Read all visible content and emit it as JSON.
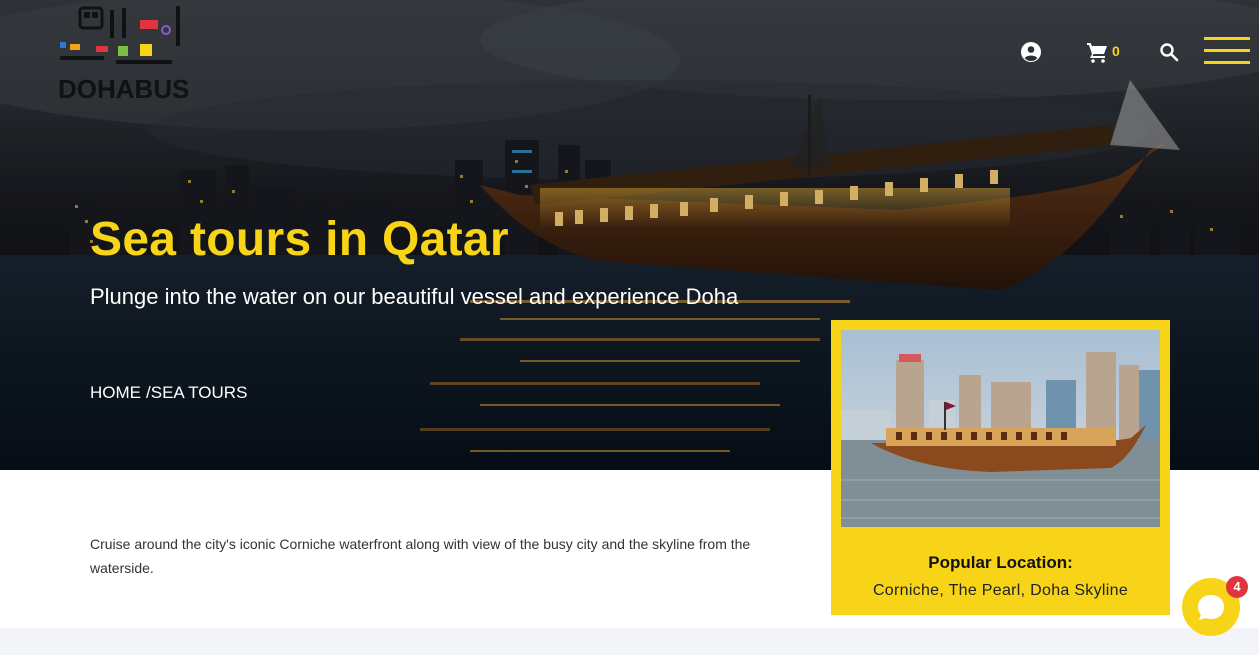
{
  "brand": {
    "logo_text": "DOHABUS"
  },
  "header": {
    "cart_count": "0",
    "icons": [
      "user-icon",
      "cart-icon",
      "search-icon",
      "menu-icon"
    ]
  },
  "hero": {
    "title": "Sea tours in Qatar",
    "subtitle": "Plunge into the water on our beautiful vessel and experience Doha",
    "breadcrumb": {
      "home": "HOME",
      "separator": "/",
      "current": "SEA TOURS"
    }
  },
  "content": {
    "description": "Cruise around the city's iconic Corniche waterfront along with view of the busy city and the skyline from the waterside."
  },
  "card": {
    "title": "Popular Location:",
    "locations": "Corniche, The Pearl, Doha Skyline"
  },
  "chat": {
    "badge_count": "4"
  },
  "colors": {
    "accent": "#f7d417",
    "badge": "#e1343f"
  }
}
